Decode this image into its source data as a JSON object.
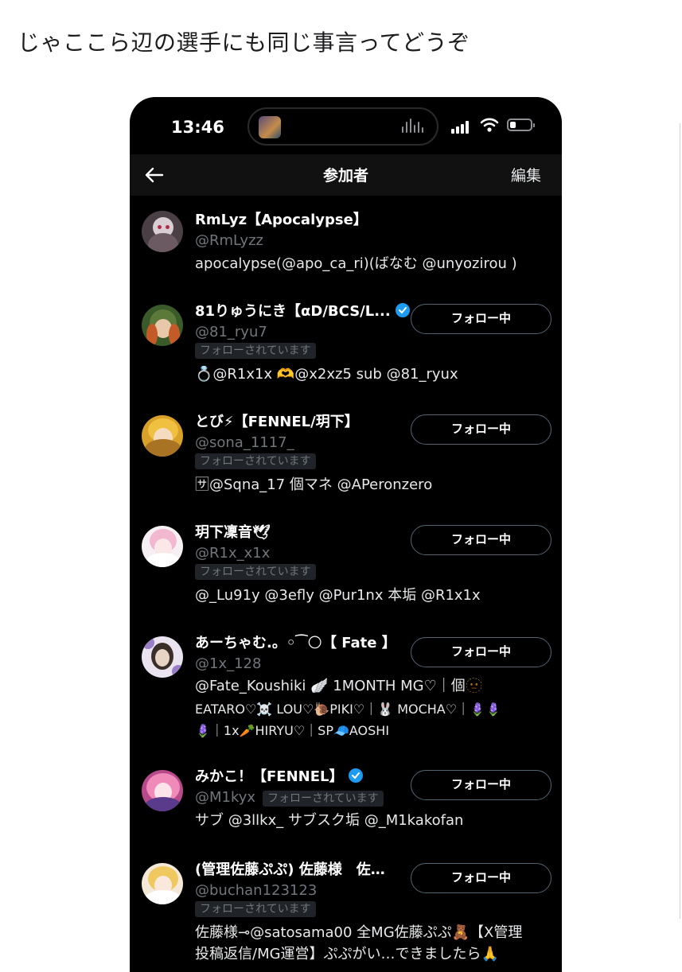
{
  "caption": "じゃここら辺の選手にも同じ事言ってどうぞ",
  "status_bar": {
    "time": "13:46"
  },
  "nav": {
    "title": "参加者",
    "edit_label": "編集"
  },
  "follow_button_label": "フォロー中",
  "follows_you_label": "フォローされています",
  "participants": [
    {
      "name": "RmLyz【Apocalypse】",
      "handle": "@RmLyzz",
      "bio": "apocalypse(@apo_ca_ri)(ばなむ @unyozirou )",
      "verified": false,
      "following": false,
      "follows_you": false
    },
    {
      "name": "81りゅうにき【αD/BCS/L...",
      "handle": "@81_ryu7",
      "bio": "💍@R1x1x 🫶@x2xz5 sub @81_ryux",
      "verified": true,
      "following": true,
      "follows_you": true
    },
    {
      "name": "とび⚡【FENNEL/玥下】",
      "handle": "@sona_1117_",
      "bio": "🈂@Sqna_17 個マネ @APeronzero",
      "verified": false,
      "following": true,
      "follows_you": true
    },
    {
      "name": "玥下凜音🕊",
      "handle": "@R1x_x1x",
      "bio": "@_Lu91y @3efly @Pur1nx 本垢 @R1x1x",
      "verified": false,
      "following": true,
      "follows_you": true
    },
    {
      "name": "あーちゃむ.。◦⁀🌕【 Fate 】",
      "handle": "@1x_128",
      "bio_lines": [
        "@Fate_Koushiki 🪽 1MONTH MG♡｜個🫥",
        "EATARO♡☠️ LOU♡🐌PIKI♡｜🐰 MOCHA♡｜🪻🪻",
        "🪻｜1x🥕HIRYU♡｜SP🧢AOSHI"
      ],
      "verified": false,
      "following": true,
      "follows_you": false
    },
    {
      "name": "みかこ！【FENNEL】",
      "handle": "@M1kyx",
      "bio": "サブ @3llkx_ サブスク垢 @_M1kakofan",
      "verified": true,
      "following": true,
      "follows_you": true
    },
    {
      "name": "(管理佐藤ぷぷ) 佐藤様　佐…",
      "handle": "@buchan123123",
      "bio": "佐藤様⊸@satosama00 全MG佐藤ぷぷ🧸【X管理",
      "bio_cut": "投稿返信/MG運営】ぷぷがい…できましたら🙏",
      "verified": false,
      "following": true,
      "follows_you": true
    }
  ]
}
